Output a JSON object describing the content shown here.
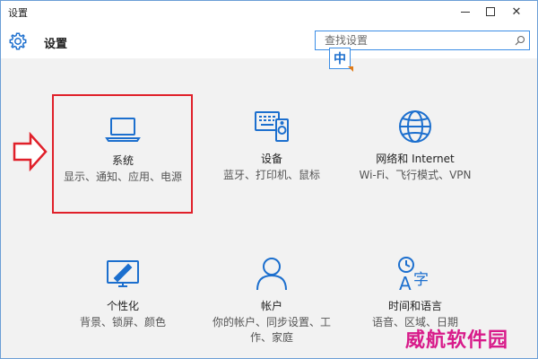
{
  "window": {
    "title": "设置"
  },
  "header": {
    "title": "设置"
  },
  "search": {
    "placeholder": "查找设置"
  },
  "ime": {
    "label": "中"
  },
  "tiles": [
    {
      "icon": "laptop-icon",
      "name": "系统",
      "desc": "显示、通知、应用、电源"
    },
    {
      "icon": "devices-icon",
      "name": "设备",
      "desc": "蓝牙、打印机、鼠标"
    },
    {
      "icon": "globe-icon",
      "name": "网络和 Internet",
      "desc": "Wi-Fi、飞行模式、VPN"
    },
    {
      "icon": "personalization-icon",
      "name": "个性化",
      "desc": "背景、锁屏、颜色"
    },
    {
      "icon": "person-icon",
      "name": "帐户",
      "desc": "你的帐户、同步设置、工作、家庭"
    },
    {
      "icon": "time-language-icon",
      "name": "时间和语言",
      "desc": "语音、区域、日期"
    }
  ],
  "watermark": "威航软件园",
  "colors": {
    "accent": "#1c6fce",
    "highlight": "#e0202a",
    "watermark": "#d81b8a"
  }
}
